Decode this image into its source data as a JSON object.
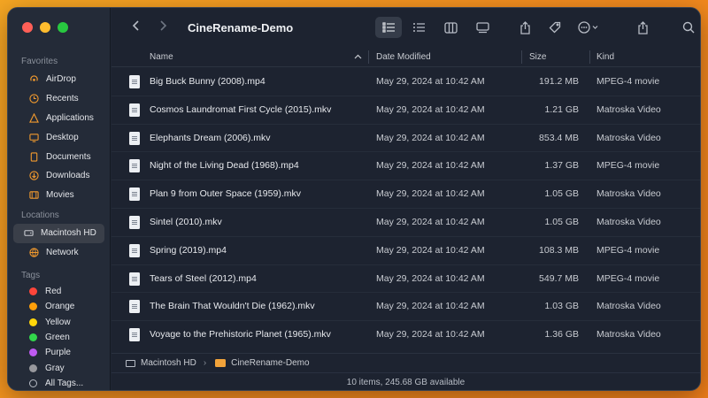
{
  "window": {
    "title": "CineRename-Demo"
  },
  "sidebar": {
    "favorites_header": "Favorites",
    "favorites": [
      {
        "label": "AirDrop",
        "icon": "airdrop-icon"
      },
      {
        "label": "Recents",
        "icon": "clock-icon"
      },
      {
        "label": "Applications",
        "icon": "applications-icon"
      },
      {
        "label": "Desktop",
        "icon": "desktop-icon"
      },
      {
        "label": "Documents",
        "icon": "document-icon"
      },
      {
        "label": "Downloads",
        "icon": "download-icon"
      },
      {
        "label": "Movies",
        "icon": "film-icon"
      }
    ],
    "locations_header": "Locations",
    "locations": [
      {
        "label": "Macintosh HD",
        "icon": "harddrive-icon",
        "selected": true
      },
      {
        "label": "Network",
        "icon": "globe-icon"
      }
    ],
    "tags_header": "Tags",
    "tags": [
      {
        "label": "Red",
        "color": "#ff453a"
      },
      {
        "label": "Orange",
        "color": "#ff9f0a"
      },
      {
        "label": "Yellow",
        "color": "#ffd60a"
      },
      {
        "label": "Green",
        "color": "#32d74b"
      },
      {
        "label": "Purple",
        "color": "#bf5af2"
      },
      {
        "label": "Gray",
        "color": "#98989d"
      },
      {
        "label": "All Tags...",
        "icon": "all-tags-icon"
      }
    ]
  },
  "columns": {
    "name": "Name",
    "date": "Date Modified",
    "size": "Size",
    "kind": "Kind"
  },
  "files": [
    {
      "name": "Big Buck Bunny (2008).mp4",
      "date": "May 29, 2024 at 10:42 AM",
      "size": "191.2 MB",
      "kind": "MPEG-4 movie"
    },
    {
      "name": "Cosmos Laundromat First Cycle (2015).mkv",
      "date": "May 29, 2024 at 10:42 AM",
      "size": "1.21 GB",
      "kind": "Matroska Video"
    },
    {
      "name": "Elephants Dream (2006).mkv",
      "date": "May 29, 2024 at 10:42 AM",
      "size": "853.4 MB",
      "kind": "Matroska Video"
    },
    {
      "name": "Night of the Living Dead (1968).mp4",
      "date": "May 29, 2024 at 10:42 AM",
      "size": "1.37 GB",
      "kind": "MPEG-4 movie"
    },
    {
      "name": "Plan 9 from Outer Space (1959).mkv",
      "date": "May 29, 2024 at 10:42 AM",
      "size": "1.05 GB",
      "kind": "Matroska Video"
    },
    {
      "name": "Sintel (2010).mkv",
      "date": "May 29, 2024 at 10:42 AM",
      "size": "1.05 GB",
      "kind": "Matroska Video"
    },
    {
      "name": "Spring (2019).mp4",
      "date": "May 29, 2024 at 10:42 AM",
      "size": "108.3 MB",
      "kind": "MPEG-4 movie"
    },
    {
      "name": "Tears of Steel (2012).mp4",
      "date": "May 29, 2024 at 10:42 AM",
      "size": "549.7 MB",
      "kind": "MPEG-4 movie"
    },
    {
      "name": "The Brain That Wouldn't Die (1962).mkv",
      "date": "May 29, 2024 at 10:42 AM",
      "size": "1.03 GB",
      "kind": "Matroska Video"
    },
    {
      "name": "Voyage to the Prehistoric Planet (1965).mkv",
      "date": "May 29, 2024 at 10:42 AM",
      "size": "1.36 GB",
      "kind": "Matroska Video"
    }
  ],
  "pathbar": {
    "root": "Macintosh HD",
    "folder": "CineRename-Demo"
  },
  "status": {
    "text": "10 items, 245.68 GB available"
  }
}
